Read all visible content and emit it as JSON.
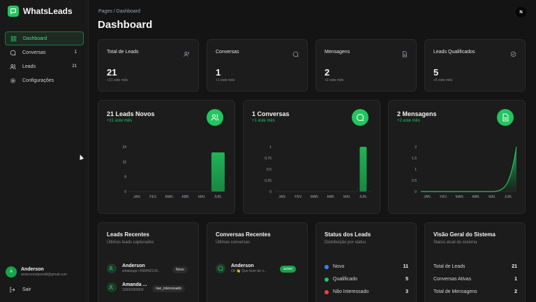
{
  "app": {
    "brand": "WhatsLeads",
    "corner_badge": "N"
  },
  "sidebar": {
    "items": [
      {
        "label": "Dashboard",
        "icon": "grid-icon",
        "count": ""
      },
      {
        "label": "Conversas",
        "icon": "chat-icon",
        "count": "1"
      },
      {
        "label": "Leads",
        "icon": "users-icon",
        "count": "21"
      },
      {
        "label": "Configurações",
        "icon": "gear-icon",
        "count": ""
      }
    ],
    "user": {
      "initial": "A",
      "name": "Anderson",
      "email": "andersondasmdil@gmail.com"
    },
    "logout_label": "Sair"
  },
  "header": {
    "breadcrumb": "Pages / Dashboard",
    "title": "Dashboard"
  },
  "stats": [
    {
      "title": "Total de Leads",
      "value": "21",
      "sub": "+21 este mês",
      "icon": "users-icon"
    },
    {
      "title": "Conversas",
      "value": "1",
      "sub": "+1 este mês",
      "icon": "chat-icon"
    },
    {
      "title": "Mensagens",
      "value": "2",
      "sub": "+2 este mês",
      "icon": "document-icon"
    },
    {
      "title": "Leads Qualificados",
      "value": "5",
      "sub": "+5 este mês",
      "icon": "check-circle-icon"
    }
  ],
  "chart_cards": [
    {
      "title": "21 Leads Novos",
      "sub": "+21 este mês",
      "icon": "users-icon"
    },
    {
      "title": "1 Conversas",
      "sub": "+1 este mês",
      "icon": "chat-icon"
    },
    {
      "title": "2 Mensagens",
      "sub": "+2 este mês",
      "icon": "document-icon"
    }
  ],
  "chart_data": [
    {
      "type": "bar",
      "categories": [
        "JAN.",
        "FEV.",
        "MAR.",
        "ABR.",
        "MAI.",
        "JUN."
      ],
      "values": [
        0,
        0,
        0,
        0,
        0,
        21
      ],
      "yticks": [
        "0",
        "8",
        "16",
        "24"
      ],
      "ylim": [
        0,
        24
      ],
      "color": "#22c55e"
    },
    {
      "type": "bar",
      "categories": [
        "JAN.",
        "FEV.",
        "MAR.",
        "ABR.",
        "MAI.",
        "JUN."
      ],
      "values": [
        0,
        0,
        0,
        0,
        0,
        1
      ],
      "yticks": [
        "0",
        "0.25",
        "0.5",
        "0.75",
        "1"
      ],
      "ylim": [
        0,
        1
      ],
      "color": "#22c55e"
    },
    {
      "type": "area",
      "categories": [
        "JAN.",
        "FEV.",
        "MAR.",
        "ABR.",
        "MAI.",
        "JUN."
      ],
      "values": [
        0,
        0,
        0,
        0,
        0,
        2
      ],
      "yticks": [
        "0",
        "0.5",
        "1",
        "1.5",
        "2"
      ],
      "ylim": [
        0,
        2
      ],
      "color": "#22c55e"
    }
  ],
  "recent_leads": {
    "title": "Leads Recentes",
    "sub": "Últimos leads capturados",
    "items": [
      {
        "name": "Anderson",
        "meta": "whatsapp:+558492134...",
        "badge": "Novo"
      },
      {
        "name": "Amanda ...",
        "meta": "10000000000",
        "badge": "nao_interessado"
      }
    ]
  },
  "recent_conversations": {
    "title": "Conversas Recentes",
    "sub": "Últimas conversas",
    "items": [
      {
        "name": "Anderson",
        "meta": "Oi! 👋 Que bom ter v...",
        "badge": "active"
      }
    ]
  },
  "lead_status": {
    "title": "Status dos Leads",
    "sub": "Distribuição por status",
    "items": [
      {
        "label": "Novo",
        "value": "11",
        "color": "#3b82f6"
      },
      {
        "label": "Qualificado",
        "value": "5",
        "color": "#22c55e"
      },
      {
        "label": "Não Interessado",
        "value": "3",
        "color": "#ef4444"
      }
    ]
  },
  "system": {
    "title": "Visão Geral do Sistema",
    "sub": "Status atual do sistema",
    "items": [
      {
        "label": "Total de Leads",
        "value": "21"
      },
      {
        "label": "Conversas Ativas",
        "value": "1"
      },
      {
        "label": "Total de Mensagens",
        "value": "2"
      }
    ]
  }
}
